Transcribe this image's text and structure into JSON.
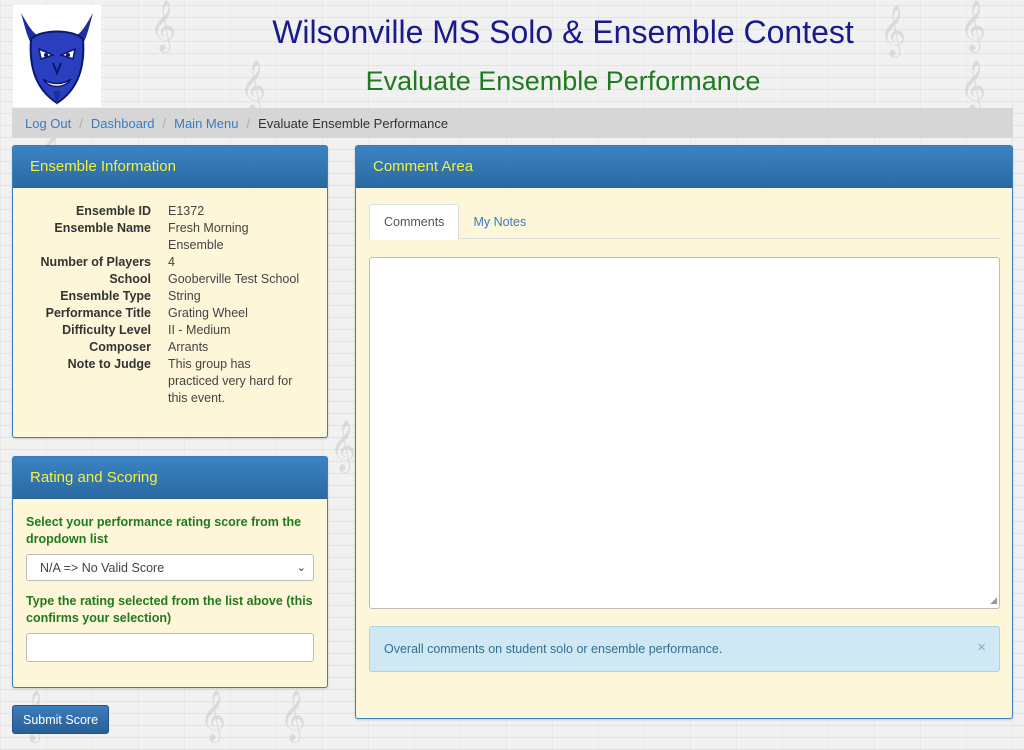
{
  "header": {
    "title": "Wilsonville MS Solo & Ensemble Contest",
    "subtitle": "Evaluate Ensemble Performance"
  },
  "breadcrumb": {
    "items": [
      "Log Out",
      "Dashboard",
      "Main Menu"
    ],
    "current": "Evaluate Ensemble Performance"
  },
  "ensemble_info": {
    "heading": "Ensemble Information",
    "rows": [
      {
        "label": "Ensemble ID",
        "value": "E1372"
      },
      {
        "label": "Ensemble Name",
        "value": "Fresh Morning Ensemble"
      },
      {
        "label": "Number of Players",
        "value": "4"
      },
      {
        "label": "School",
        "value": "Gooberville Test School"
      },
      {
        "label": "Ensemble Type",
        "value": "String"
      },
      {
        "label": "Performance Title",
        "value": "Grating Wheel"
      },
      {
        "label": "Difficulty Level",
        "value": "II - Medium"
      },
      {
        "label": "Composer",
        "value": "Arrants"
      },
      {
        "label": "Note to Judge",
        "value": "This group has practiced very hard for this event."
      }
    ]
  },
  "rating": {
    "heading": "Rating and Scoring",
    "select_label": "Select your performance rating score from the dropdown list",
    "select_value": "N/A => No Valid Score",
    "confirm_label": "Type the rating selected from the list above (this confirms your selection)",
    "confirm_value": ""
  },
  "submit_label": "Submit Score",
  "comment_area": {
    "heading": "Comment Area",
    "tabs": [
      "Comments",
      "My Notes"
    ],
    "active_tab": "Comments",
    "alert_text": "Overall comments on student solo or ensemble performance.",
    "alert_close": "×"
  },
  "colors": {
    "panel_header": "#2f74b0",
    "panel_header_text": "#f5f03a",
    "panel_body": "#fdf6d8",
    "title": "#1a1a8c",
    "subtitle": "#1e7b1e",
    "link": "#3a7bbf",
    "alert_bg": "#cfe8f3"
  },
  "icons": {
    "logo": "blue-devil-mascot-logo",
    "dropdown": "chevron-down-icon",
    "alert_close": "close-icon"
  }
}
